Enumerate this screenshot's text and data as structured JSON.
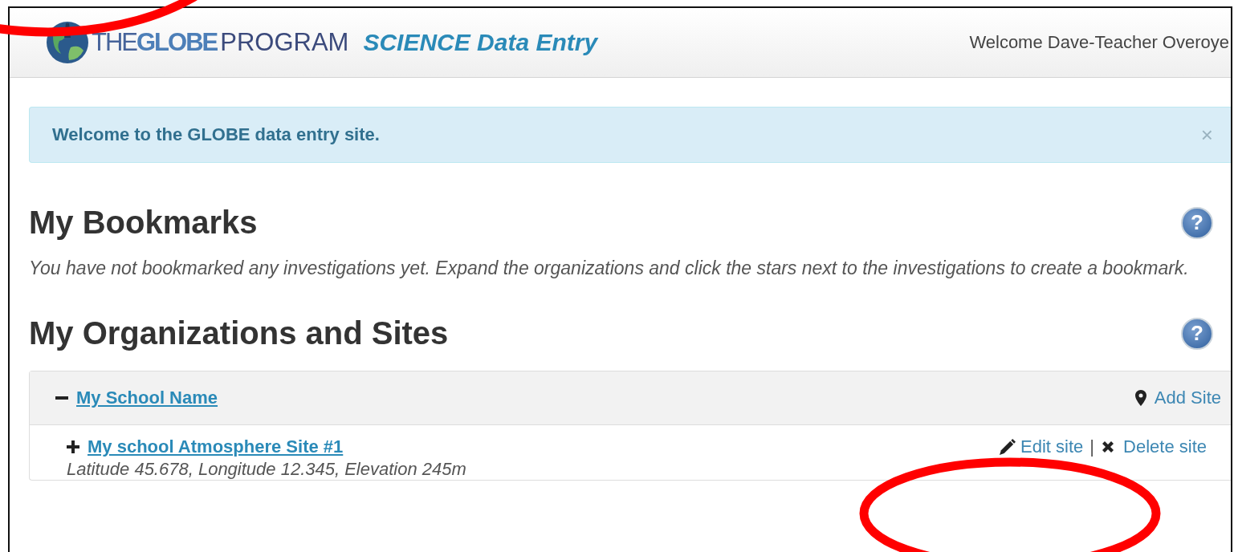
{
  "header": {
    "logo_parts": [
      "THE",
      "GLOBE",
      "PROGRAM"
    ],
    "app_title": "SCIENCE Data Entry",
    "welcome": "Welcome Dave-Teacher Overoye"
  },
  "alert": {
    "message": "Welcome to the GLOBE data entry site.",
    "close": "×"
  },
  "sections": [
    {
      "title": "My Bookmarks",
      "help": "?",
      "text": "You have not bookmarked any investigations yet. Expand the organizations and click the stars next to the investigations to create a bookmark."
    },
    {
      "title": "My Organizations and Sites",
      "help": "?"
    }
  ],
  "organizations": [
    {
      "name": "My School Name",
      "expanded": true,
      "add_label": "Add Site",
      "sites": [
        {
          "name": "My school Atmosphere Site #1",
          "expanded": false,
          "edit_label": "Edit site",
          "separator": "|",
          "delete_label": "Delete site",
          "details": "Latitude 45.678, Longitude 12.345, Elevation 245m"
        }
      ]
    }
  ],
  "annotations": [
    {
      "kind": "ellipse"
    },
    {
      "kind": "ellipse"
    }
  ]
}
